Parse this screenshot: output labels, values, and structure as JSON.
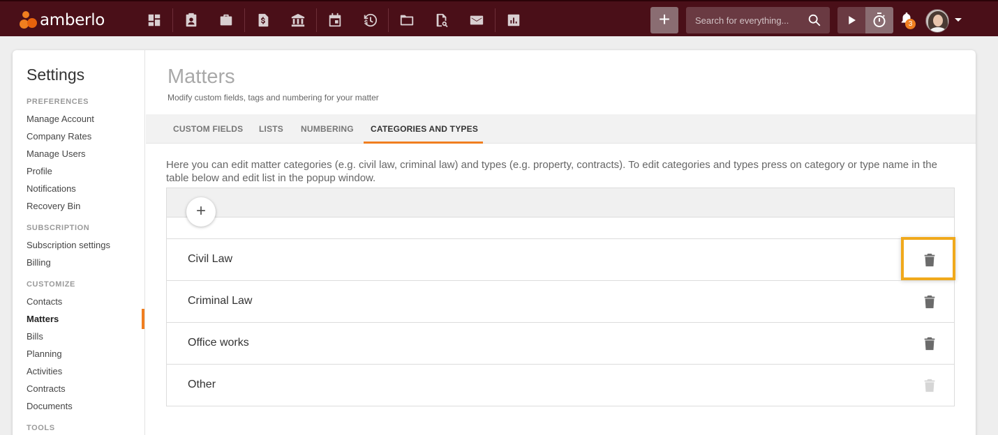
{
  "app": {
    "logo_text": "amberlo",
    "accent_color": "#f07e1f",
    "topbar_color": "#4a0f18"
  },
  "nav_icons": [
    "dashboard-icon",
    "contacts-icon",
    "briefcase-icon",
    "invoice-icon",
    "bank-icon",
    "calendar-icon",
    "time-money-icon",
    "folder-icon",
    "document-search-icon",
    "mail-icon",
    "reports-icon"
  ],
  "topbar": {
    "search_placeholder": "Search for everything...",
    "notification_count": "3"
  },
  "sidebar": {
    "title": "Settings",
    "sections": [
      {
        "label": "PREFERENCES",
        "items": [
          "Manage Account",
          "Company Rates",
          "Manage Users",
          "Profile",
          "Notifications",
          "Recovery Bin"
        ]
      },
      {
        "label": "SUBSCRIPTION",
        "items": [
          "Subscription settings",
          "Billing"
        ]
      },
      {
        "label": "CUSTOMIZE",
        "items": [
          "Contacts",
          "Matters",
          "Bills",
          "Planning",
          "Activities",
          "Contracts",
          "Documents"
        ]
      },
      {
        "label": "TOOLS",
        "items": []
      }
    ],
    "active_item": "Matters"
  },
  "main": {
    "title": "Matters",
    "subtitle": "Modify custom fields, tags and numbering for your matter",
    "tabs": [
      {
        "label": "CUSTOM FIELDS"
      },
      {
        "label": "LISTS"
      },
      {
        "label": "NUMBERING"
      },
      {
        "label": "CATEGORIES AND TYPES"
      }
    ],
    "active_tab": "CATEGORIES AND TYPES",
    "description": "Here you can edit matter categories (e.g. civil law, criminal law) and types (e.g. property, contracts). To edit categories and types press on category or type name in the table below and edit list in the popup window.",
    "categories": [
      {
        "name": "Civil Law",
        "deletable": true
      },
      {
        "name": "Criminal Law",
        "deletable": true
      },
      {
        "name": "Office works",
        "deletable": true
      },
      {
        "name": "Other",
        "deletable": false
      }
    ]
  }
}
